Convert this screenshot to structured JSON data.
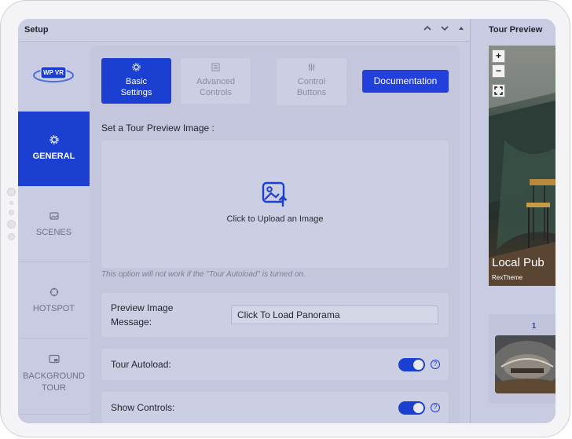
{
  "setup": {
    "title": "Setup",
    "icons": {
      "collapse": "chevron-up-icon",
      "expand": "chevron-down-icon",
      "toggle": "caret-up-icon"
    }
  },
  "logo": {
    "text": "WP VR"
  },
  "sidebar": {
    "items": [
      {
        "label": "GENERAL",
        "icon": "gear-icon",
        "active": true
      },
      {
        "label": "SCENES",
        "icon": "image-icon",
        "active": false
      },
      {
        "label": "HOTSPOT",
        "icon": "crosshair-icon",
        "active": false
      },
      {
        "label": "BACKGROUND TOUR",
        "icon": "picture-in-picture-icon",
        "active": false
      }
    ]
  },
  "tabs": [
    {
      "label": "Basic Settings",
      "icon": "gear-icon",
      "active": true
    },
    {
      "label": "Advanced Controls",
      "icon": "list-icon",
      "active": false
    },
    {
      "label": "Control Buttons",
      "icon": "sliders-icon",
      "active": false
    }
  ],
  "documentation_button": "Documentation",
  "preview_image": {
    "label": "Set a Tour Preview Image :",
    "upload_text": "Click to Upload an Image",
    "note": "This option will not work if the \"Tour Autoload\" is turned on."
  },
  "fields": {
    "preview_message": {
      "label": "Preview Image Message:",
      "value": "Click To Load Panorama"
    },
    "tour_autoload": {
      "label": "Tour Autoload:",
      "enabled": true
    },
    "show_controls": {
      "label": "Show Controls:",
      "enabled": true
    }
  },
  "preview": {
    "title": "Tour Preview",
    "controls": [
      "+",
      "−"
    ],
    "scene_title": "Local Pub",
    "scene_subtitle": "RexTheme",
    "scene_number": "1"
  },
  "colors": {
    "accent": "#1a3fd1",
    "button": "#2440dc",
    "overlay": "#c9cbe2"
  }
}
